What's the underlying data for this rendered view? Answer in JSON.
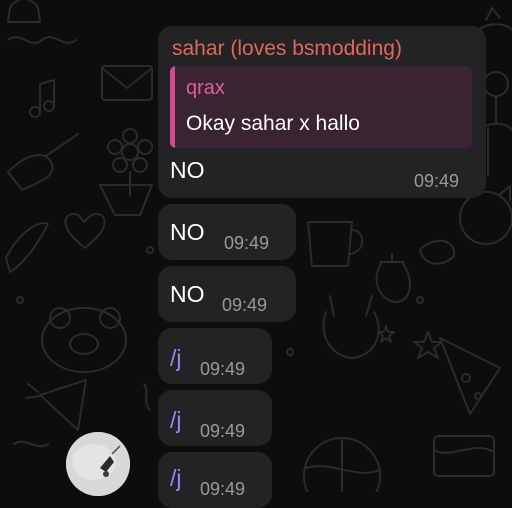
{
  "colors": {
    "background": "#0d0d0e",
    "bubble": "#232325",
    "sender_name": "#e3665a",
    "quote_accent": "#d04a8e",
    "quote_author": "#de5fa0",
    "quote_background": "#3a2431",
    "command_link": "#8f8cf0",
    "time": "#9a9a9c",
    "doodle": "#2b2b2d"
  },
  "messages": [
    {
      "sender": "sahar (loves bsmodding)",
      "reply": {
        "author": "qrax",
        "text": "Okay sahar x hallo"
      },
      "text": "NO",
      "time": "09:49"
    },
    {
      "text": "NO",
      "time": "09:49"
    },
    {
      "text": "NO",
      "time": "09:49"
    },
    {
      "text": "/j",
      "time": "09:49"
    },
    {
      "text": "/j",
      "time": "09:49"
    },
    {
      "text": "/j",
      "time": "09:49"
    }
  ],
  "avatar": {
    "icon": "user-avatar-photo"
  }
}
